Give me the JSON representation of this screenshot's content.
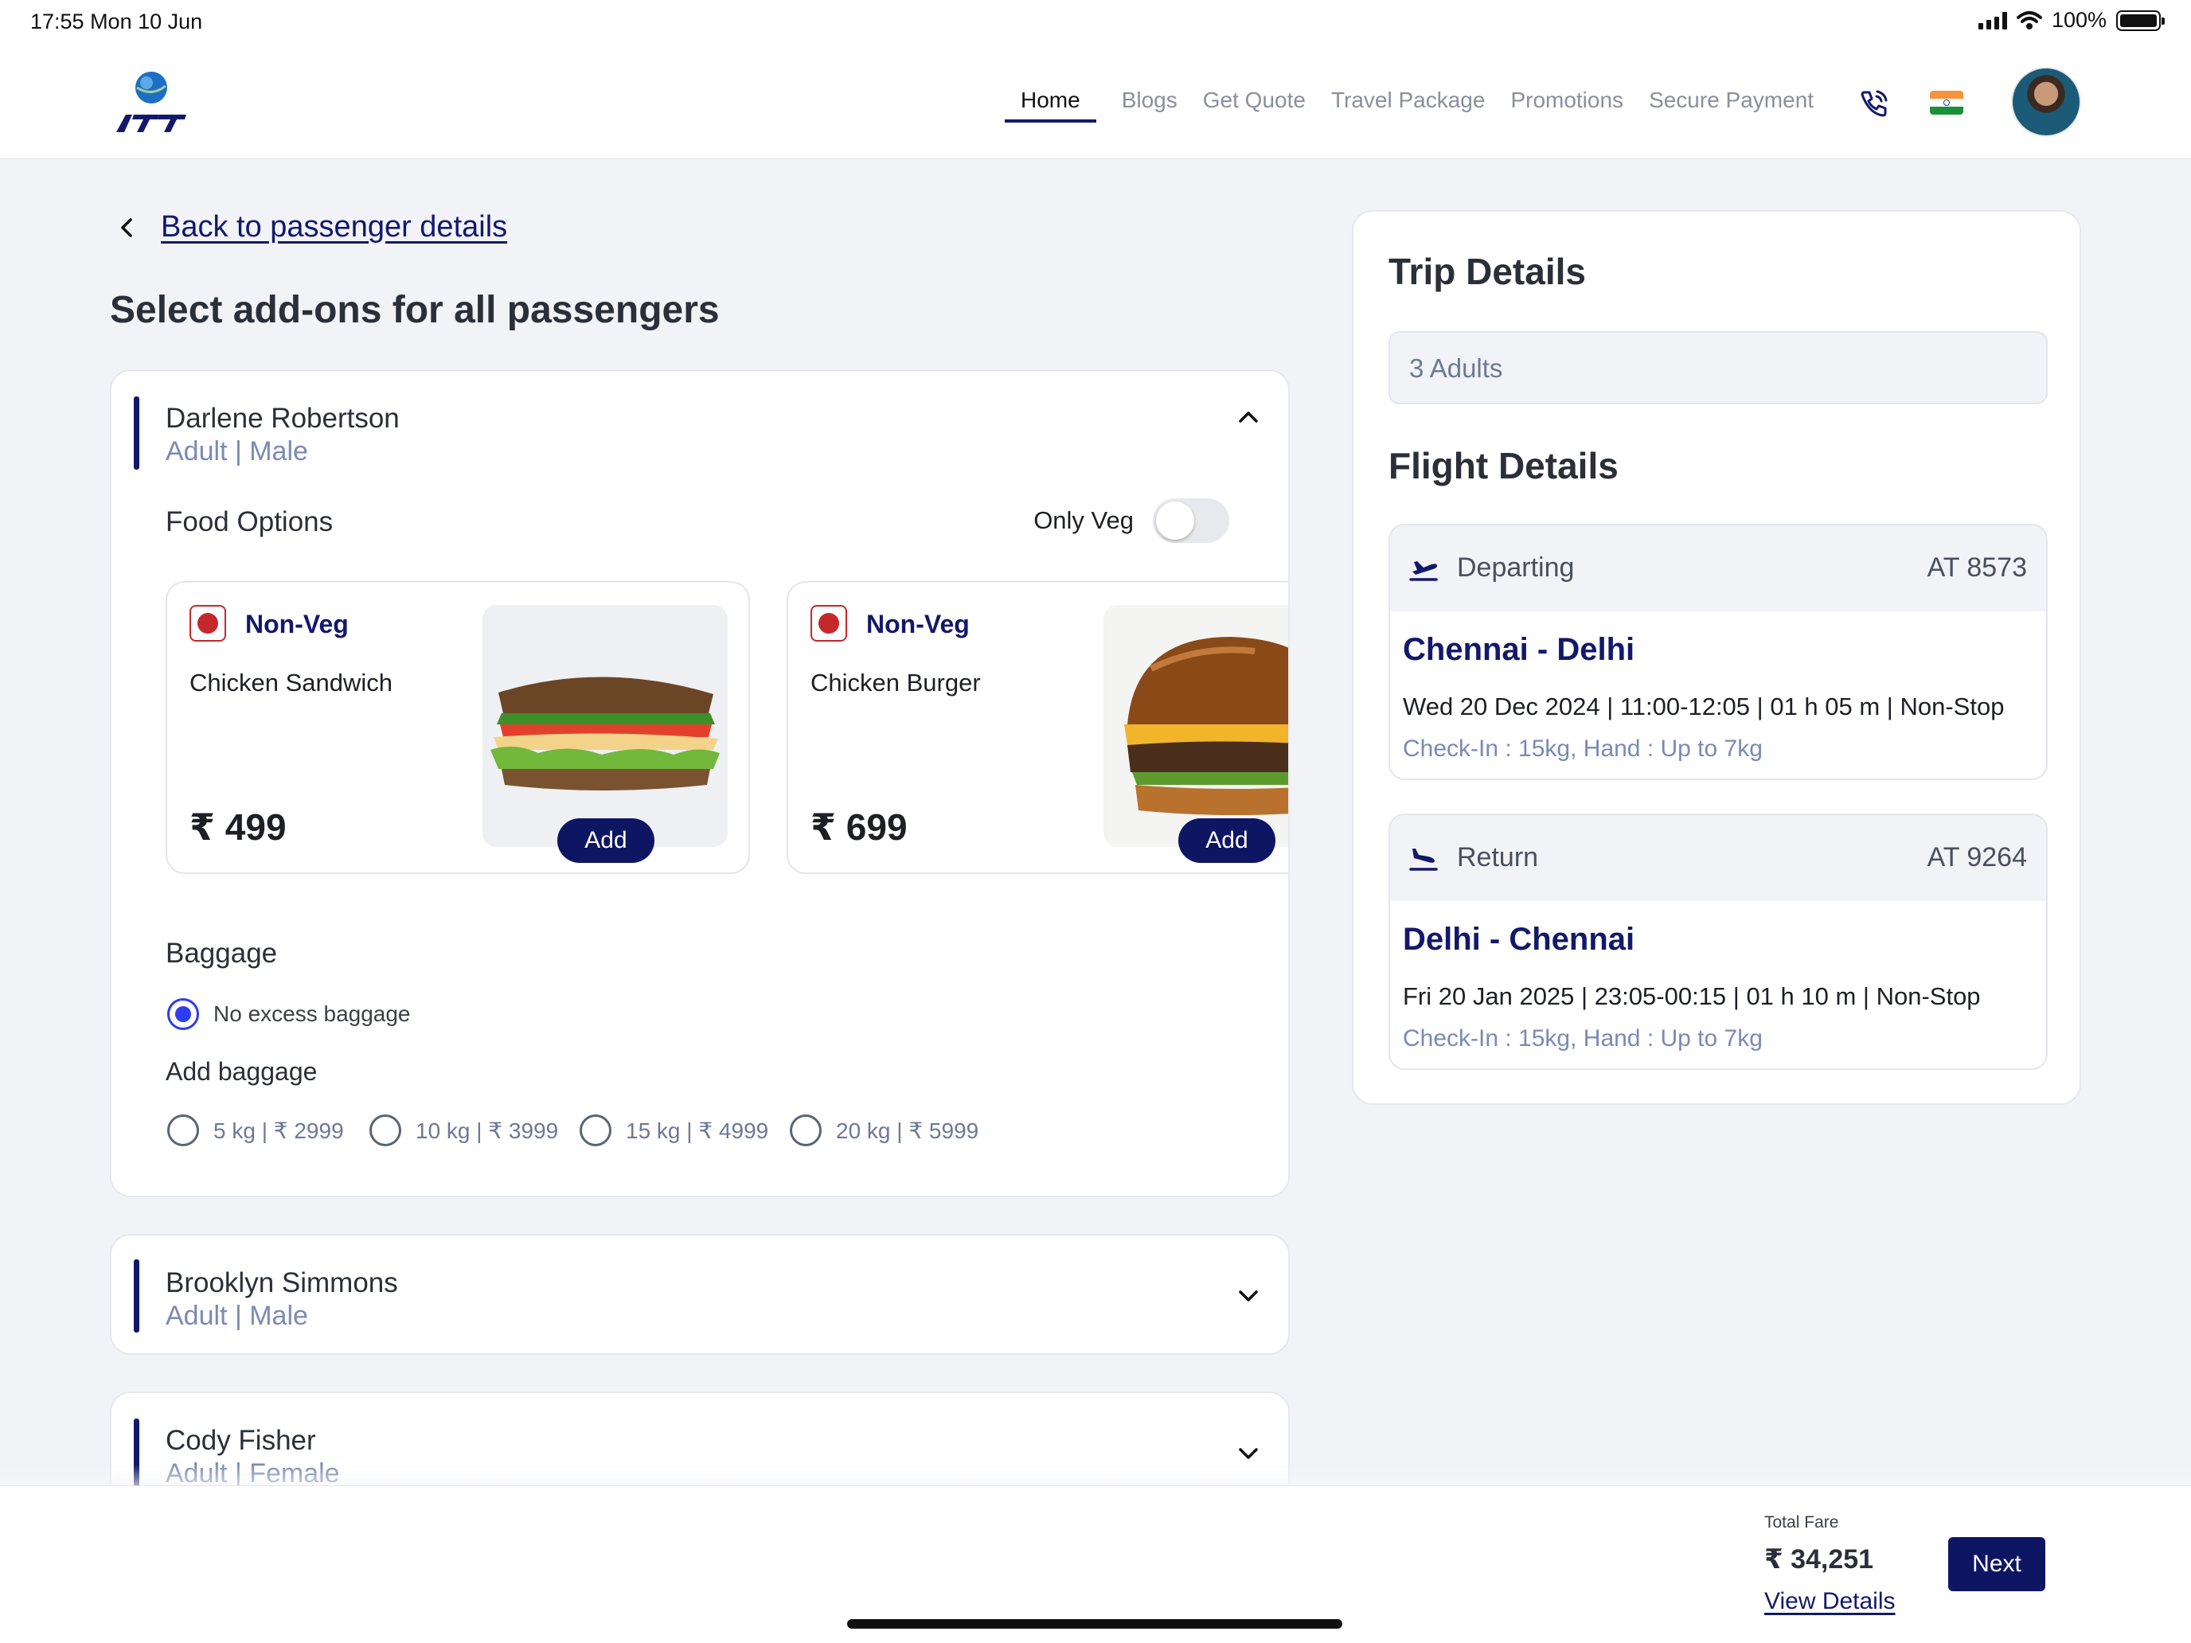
{
  "status_bar": {
    "time_date": "17:55  Mon 10 Jun",
    "battery": "100%"
  },
  "nav": {
    "items": [
      {
        "label": "Home",
        "active": true
      },
      {
        "label": "Blogs"
      },
      {
        "label": "Get Quote"
      },
      {
        "label": "Travel Package"
      },
      {
        "label": "Promotions"
      },
      {
        "label": "Secure Payment"
      }
    ]
  },
  "back_link": "Back to passenger details",
  "page_title": "Select add-ons for all passengers",
  "passengers": [
    {
      "name": "Darlene Robertson",
      "meta": "Adult | Male",
      "expanded": true,
      "food_heading": "Food Options",
      "only_veg_label": "Only Veg",
      "only_veg": false,
      "foods": [
        {
          "type": "Non-Veg",
          "name": "Chicken Sandwich",
          "price": "₹ 499",
          "add_label": "Add"
        },
        {
          "type": "Non-Veg",
          "name": "Chicken Burger",
          "price": "₹ 699",
          "add_label": "Add"
        }
      ],
      "baggage_heading": "Baggage",
      "no_excess_label": "No excess baggage",
      "add_baggage_heading": "Add baggage",
      "baggage_options": [
        "5 kg | ₹ 2999",
        "10 kg | ₹ 3999",
        "15 kg | ₹ 4999",
        "20 kg | ₹ 5999"
      ],
      "selected_baggage": "none"
    },
    {
      "name": "Brooklyn Simmons",
      "meta": "Adult | Male",
      "expanded": false
    },
    {
      "name": "Cody Fisher",
      "meta": "Adult | Female",
      "expanded": false
    }
  ],
  "trip": {
    "title": "Trip Details",
    "adults": "3 Adults",
    "flight_title": "Flight Details",
    "flights": [
      {
        "direction": "Departing",
        "code": "AT 8573",
        "route": "Chennai - Delhi",
        "schedule": "Wed 20 Dec 2024 | 11:00-12:05 | 01 h 05 m | Non-Stop",
        "baggage": "Check-In : 15kg, Hand : Up to 7kg",
        "icon": "takeoff-icon"
      },
      {
        "direction": "Return",
        "code": "AT 9264",
        "route": "Delhi - Chennai",
        "schedule": "Fri 20 Jan 2025 | 23:05-00:15 | 01 h 10 m | Non-Stop",
        "baggage": "Check-In : 15kg, Hand : Up to 7kg",
        "icon": "landing-icon"
      }
    ]
  },
  "footer": {
    "fare_label": "Total Fare",
    "fare_amount": "₹ 34,251",
    "view_details": "View Details",
    "next_label": "Next"
  },
  "colors": {
    "brand": "#12196a",
    "accent_radio": "#2c3cf0",
    "nonveg": "#c4282c",
    "muted": "#7a8ab5"
  }
}
